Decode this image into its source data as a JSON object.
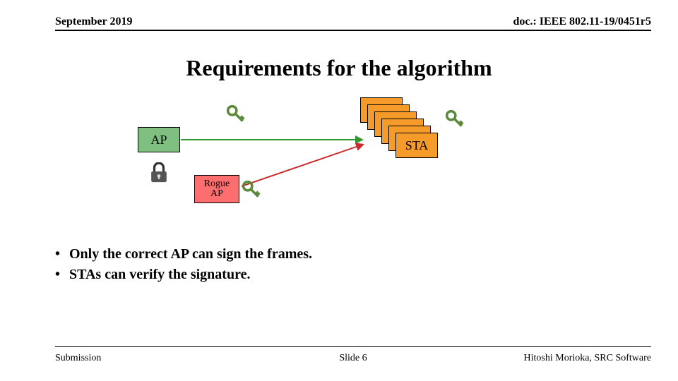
{
  "header": {
    "left": "September 2019",
    "right": "doc.: IEEE 802.11-19/0451r5"
  },
  "title": "Requirements for the algorithm",
  "nodes": {
    "ap": "AP",
    "rogue": "Rogue\nAP",
    "sta": "STA"
  },
  "icons": {
    "key_ap": "ap-private-key-icon",
    "key_rogue": "rogue-private-key-icon",
    "key_sta": "sta-public-key-icon",
    "lock": "lock-icon"
  },
  "bullets": [
    "Only the correct AP can sign the frames.",
    "STAs can verify the signature."
  ],
  "footer": {
    "left": "Submission",
    "mid": "Slide 6",
    "right": "Hitoshi Morioka, SRC Software"
  }
}
